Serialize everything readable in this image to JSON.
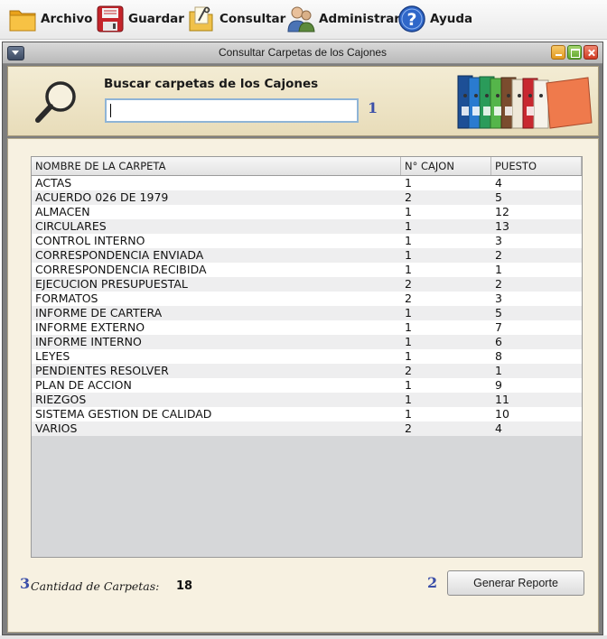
{
  "menu": {
    "items": [
      {
        "label": "Archivo",
        "icon": "folder-icon"
      },
      {
        "label": "Guardar",
        "icon": "save-disk-icon"
      },
      {
        "label": "Consultar",
        "icon": "search-document-icon"
      },
      {
        "label": "Administrar",
        "icon": "users-admin-icon"
      },
      {
        "label": "Ayuda",
        "icon": "help-question-icon"
      }
    ]
  },
  "window": {
    "title": "Consultar Carpetas de los Cajones"
  },
  "search": {
    "label": "Buscar carpetas de los Cajones",
    "value": "",
    "step_number": "1"
  },
  "table": {
    "columns": [
      "NOMBRE DE LA CARPETA",
      "N° CAJON",
      "PUESTO"
    ],
    "rows": [
      [
        "ACTAS",
        "1",
        "4"
      ],
      [
        "ACUERDO 026 DE 1979",
        "2",
        "5"
      ],
      [
        "ALMACEN",
        "1",
        "12"
      ],
      [
        "CIRCULARES",
        "1",
        "13"
      ],
      [
        "CONTROL INTERNO",
        "1",
        "3"
      ],
      [
        "CORRESPONDENCIA ENVIADA",
        "1",
        "2"
      ],
      [
        "CORRESPONDENCIA RECIBIDA",
        "1",
        "1"
      ],
      [
        "EJECUCION PRESUPUESTAL",
        "2",
        "2"
      ],
      [
        "FORMATOS",
        "2",
        "3"
      ],
      [
        "INFORME DE CARTERA",
        "1",
        "5"
      ],
      [
        "INFORME EXTERNO",
        "1",
        "7"
      ],
      [
        "INFORME INTERNO",
        "1",
        "6"
      ],
      [
        "LEYES",
        "1",
        "8"
      ],
      [
        "PENDIENTES RESOLVER",
        "2",
        "1"
      ],
      [
        "PLAN DE ACCION",
        "1",
        "9"
      ],
      [
        "RIEZGOS",
        "1",
        "11"
      ],
      [
        "SISTEMA GESTION DE CALIDAD",
        "1",
        "10"
      ],
      [
        "VARIOS",
        "2",
        "4"
      ]
    ]
  },
  "footer": {
    "count_step_number": "3",
    "count_label": "Cantidad de Carpetas:",
    "count_value": "18",
    "report_step_number": "2",
    "report_button_label": "Generar Reporte"
  },
  "colors": {
    "search_panel_bg": "#efe5c8",
    "main_panel_bg": "#f7f1e1",
    "step_number": "#3b4fa8"
  }
}
